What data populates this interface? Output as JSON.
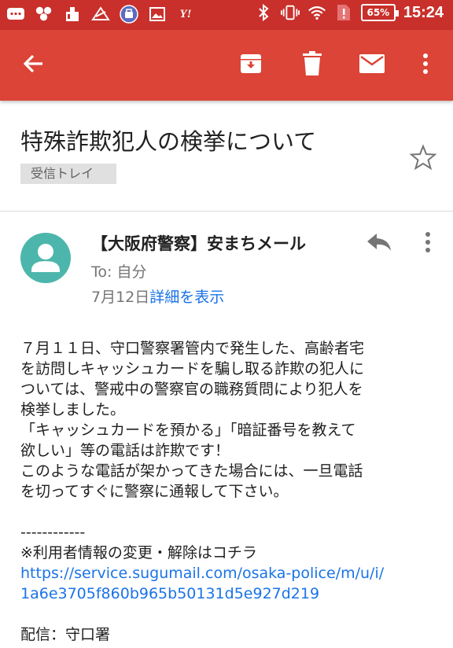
{
  "status_bar": {
    "battery": "65%",
    "time": "15:24",
    "yahoo_glyph": "Y!",
    "icons": [
      "message-icon",
      "hexagon-app-icon",
      "cleaner-app-icon",
      "gift-app-icon",
      "app-badge-icon",
      "image-icon",
      "yahoo-icon",
      "bluetooth-icon",
      "vibrate-icon",
      "wifi-icon",
      "sim-alert-icon",
      "battery-icon"
    ]
  },
  "toolbar": {
    "icons": [
      "back-arrow-icon",
      "archive-icon",
      "delete-icon",
      "mark-unread-icon",
      "more-vert-icon"
    ]
  },
  "email": {
    "subject": "特殊詐欺犯人の検挙について",
    "label": "受信トレイ",
    "sender": "【大阪府警察】安まちメール",
    "to": "To: 自分",
    "date": "7月12日",
    "details_link": "詳細を表示",
    "body_lines": [
      "７月１１日、守口警察署管内で発生した、高齢者宅",
      "を訪問しキャッシュカードを騙し取る詐欺の犯人に",
      "ついては、警戒中の警察官の職務質問により犯人を",
      "検挙しました。",
      "「キャッシュカードを預かる」「暗証番号を教えて",
      "欲しい」等の電話は詐欺です！",
      "このような電話が架かってきた場合には、一旦電話",
      "を切ってすぐに警察に通報して下さい。"
    ],
    "separator": "------------",
    "footer_notice": "※利用者情報の変更・解除はコチラ",
    "link_line1": "https://service.sugumail.com/osaka-police/m/u/i/",
    "link_line2": "1a6e3705f860b965b50131d5e927d219",
    "distributor": "配信：守口署"
  },
  "colors": {
    "status_bar": "#c9302b",
    "app_bar": "#db4437",
    "avatar": "#4db6ac",
    "link": "#1a73e8"
  }
}
